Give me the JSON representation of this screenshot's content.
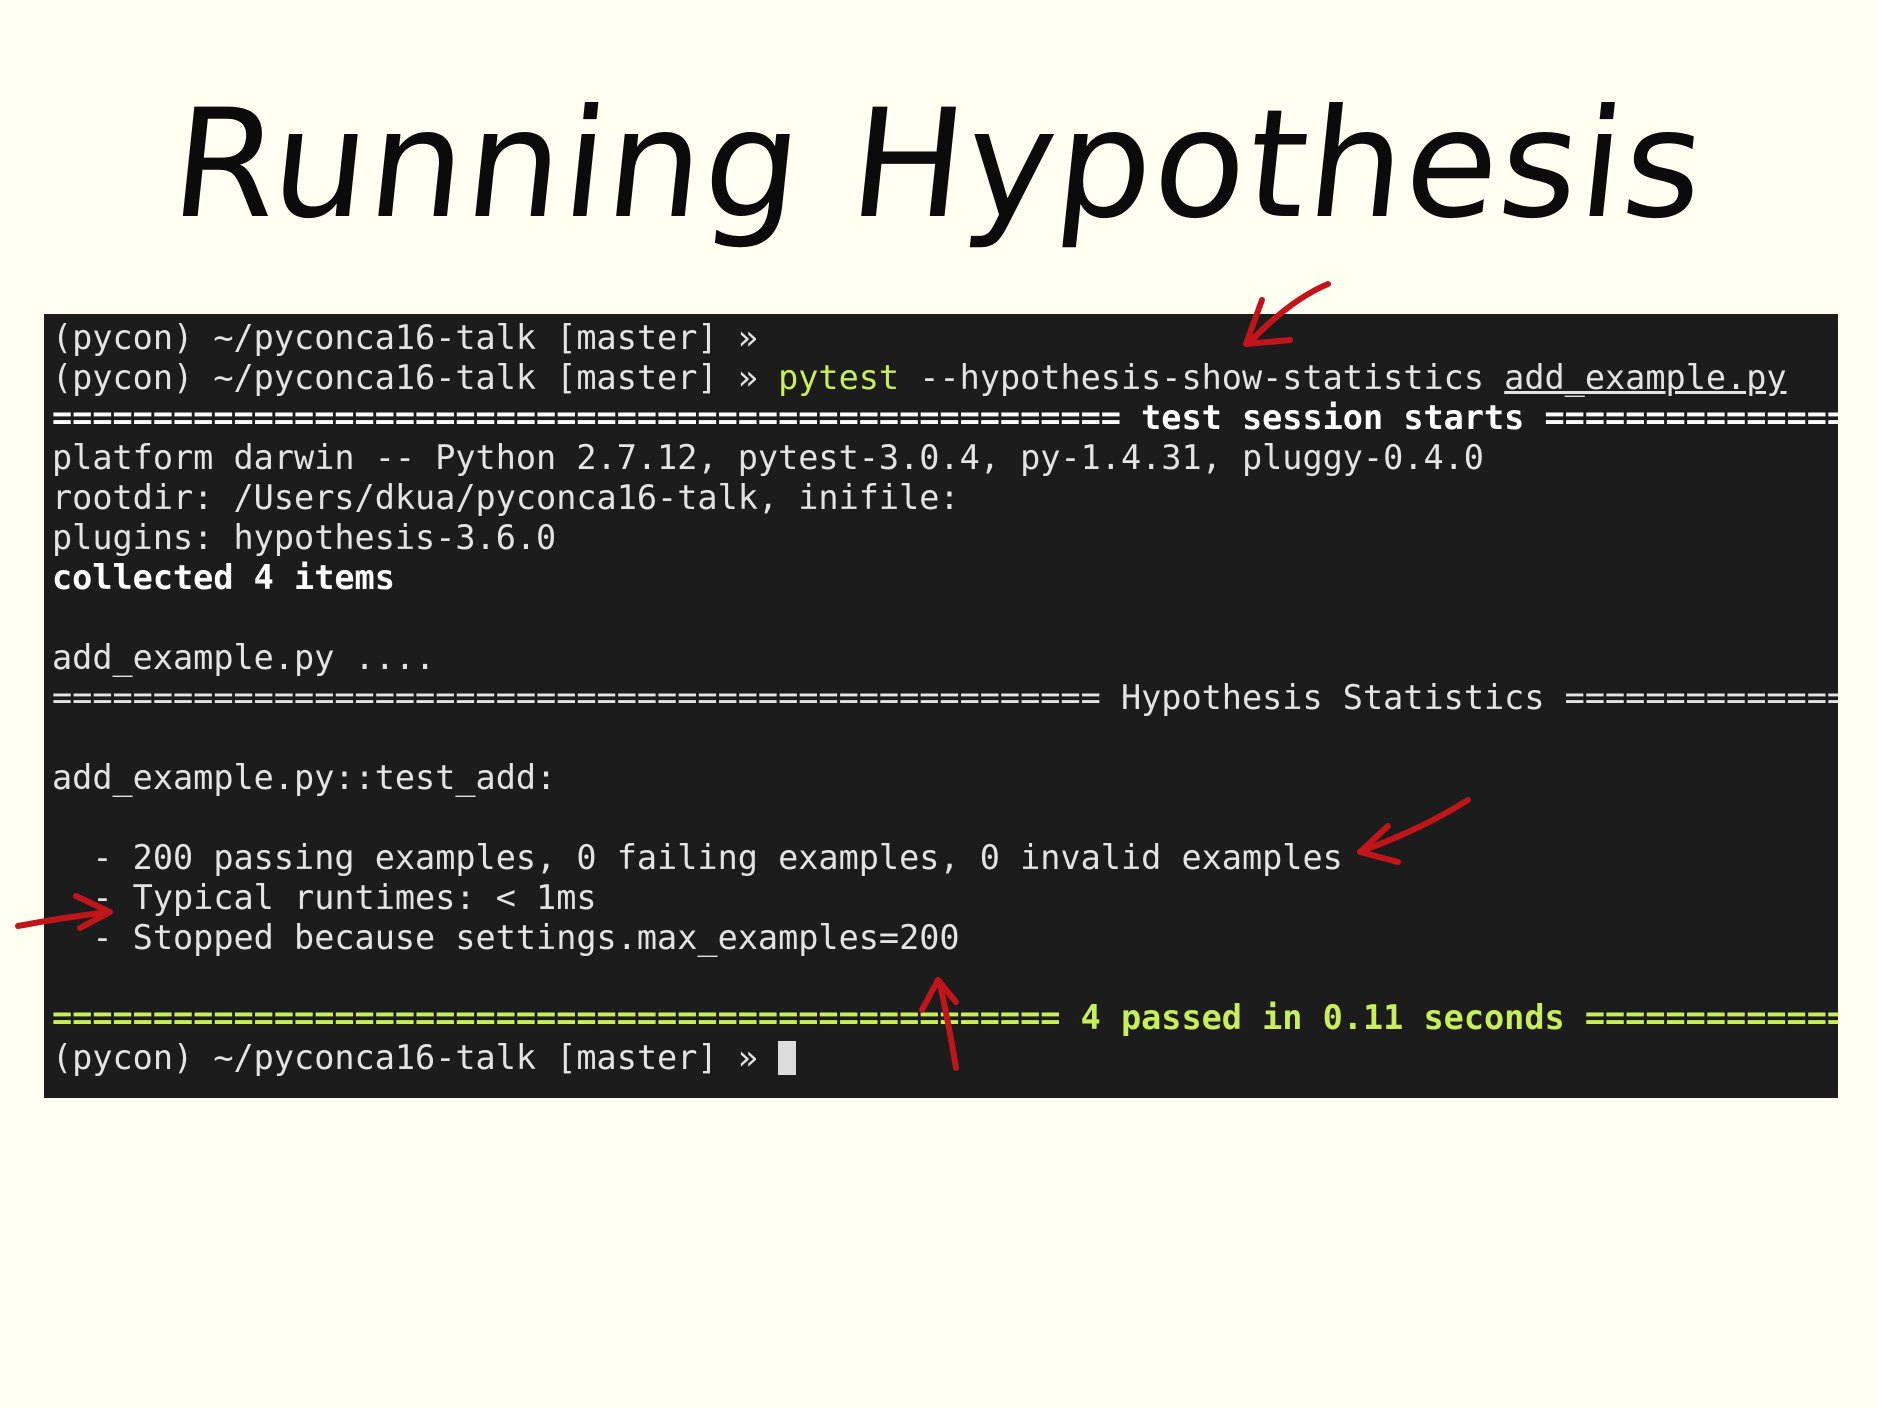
{
  "slide": {
    "title": "Running Hypothesis"
  },
  "terminal": {
    "line1": {
      "prompt": "(pycon) ~/pyconca16-talk [master] »"
    },
    "line2": {
      "prompt": "(pycon) ~/pyconca16-talk [master] »",
      "command": "pytest",
      "args": "--hypothesis-show-statistics",
      "file": "add_example.py"
    },
    "line3": {
      "rule_left": "=====================================================",
      "heading": "test session starts",
      "rule_right": "=================="
    },
    "line4": "platform darwin -- Python 2.7.12, pytest-3.0.4, py-1.4.31, pluggy-0.4.0",
    "line5": "rootdir: /Users/dkua/pyconca16-talk, inifile:",
    "line6": "plugins: hypothesis-3.6.0",
    "line7": "collected 4 items",
    "line9": "add_example.py ....",
    "line10": {
      "rule_left": "====================================================",
      "heading": "Hypothesis Statistics",
      "rule_right": "=================="
    },
    "line12": "add_example.py::test_add:",
    "line14": "  - 200 passing examples, 0 failing examples, 0 invalid examples",
    "line15": "  - Typical runtimes: < 1ms",
    "line16": "  - Stopped because settings.max_examples=200",
    "line18": {
      "rule_left": "==================================================",
      "result": "4 passed in 0.11 seconds",
      "rule_right": "=================="
    },
    "line19": {
      "prompt": "(pycon) ~/pyconca16-talk [master] »"
    }
  },
  "colors": {
    "background": "#fffff2",
    "terminal_bg": "#1c1c1c",
    "terminal_text": "#e3e3e3",
    "green": "#c8ef5b",
    "annotation_red": "#c0161b"
  },
  "annotations": [
    "arrow-to-statistics-flag",
    "arrow-to-passing-examples",
    "arrow-to-typical-runtimes",
    "arrow-to-max-examples"
  ]
}
